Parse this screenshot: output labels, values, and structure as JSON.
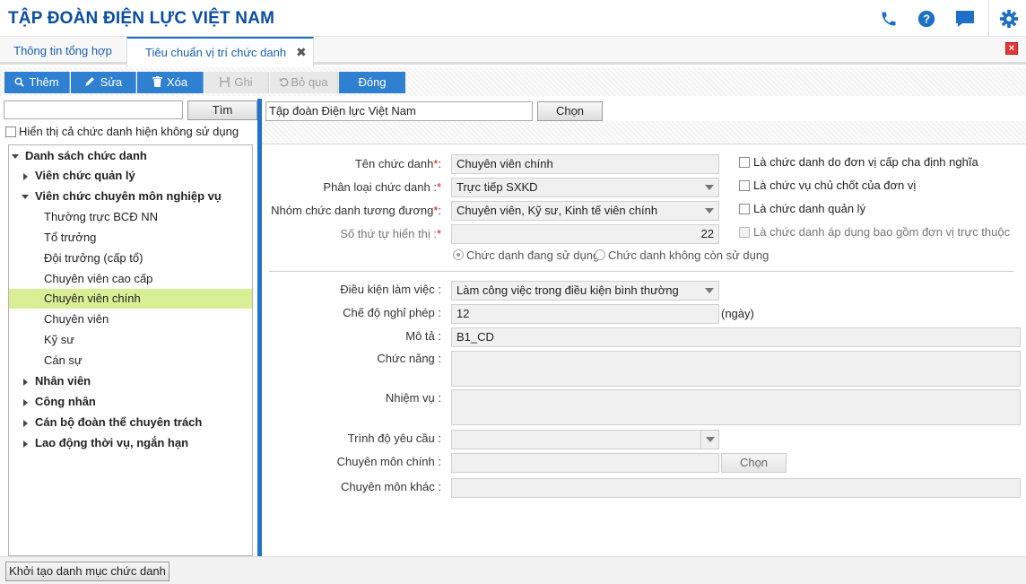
{
  "header": {
    "title": "TẬP ĐOÀN ĐIỆN LỰC VIỆT NAM",
    "icons": [
      "phone-icon",
      "help-icon",
      "chat-icon",
      "gear-icon"
    ],
    "accent": "#1e6fc6"
  },
  "tabs": [
    {
      "label": "Thông tin tổng hợp",
      "active": false
    },
    {
      "label": "Tiêu chuẩn vị trí chức danh",
      "active": true,
      "close": "✖"
    }
  ],
  "toolbar": {
    "add": "Thêm",
    "edit": "Sửa",
    "delete": "Xóa",
    "save": "Ghi",
    "skip": "Bỏ qua",
    "close": "Đóng"
  },
  "left": {
    "search_value": "",
    "search_button": "Tìm",
    "show_unused_label": "Hiển thị cả chức danh hiện không sử dụng",
    "tree": [
      {
        "label": "Danh sách chức danh",
        "level": 0,
        "expanded": true,
        "bold": true
      },
      {
        "label": "Viên chức quản lý",
        "level": 1,
        "expanded": false,
        "bold": true
      },
      {
        "label": "Viên chức chuyên môn nghiệp vụ",
        "level": 1,
        "expanded": true,
        "bold": true
      },
      {
        "label": "Thường trực BCĐ NN",
        "level": 2
      },
      {
        "label": "Tổ trưởng",
        "level": 2
      },
      {
        "label": "Đội trưởng (cấp tổ)",
        "level": 2
      },
      {
        "label": "Chuyên viên cao cấp",
        "level": 2
      },
      {
        "label": "Chuyên viên chính",
        "level": 2,
        "selected": true
      },
      {
        "label": "Chuyên viên",
        "level": 2
      },
      {
        "label": "Kỹ sư",
        "level": 2
      },
      {
        "label": "Cán sự",
        "level": 2
      },
      {
        "label": "Nhân viên",
        "level": 1,
        "expanded": false,
        "bold": true
      },
      {
        "label": "Công nhân",
        "level": 1,
        "expanded": false,
        "bold": true
      },
      {
        "label": "Cán bộ đoàn thể chuyên trách",
        "level": 1,
        "expanded": false,
        "bold": true
      },
      {
        "label": "Lao động thời vụ, ngắn hạn",
        "level": 1,
        "expanded": false,
        "bold": true
      }
    ],
    "init_button": "Khởi tạo danh mục chức danh"
  },
  "right": {
    "org_value": "Tập đoàn Điện lực Việt Nam",
    "org_choose": "Chọn",
    "fields": {
      "title_label": "Tên chức danh",
      "title_value": "Chuyên viên chính",
      "type_label": "Phân loại chức danh :",
      "type_value": "Trực tiếp SXKD",
      "group_label": "Nhóm chức danh tương đương",
      "group_value": "Chuyên viên, Kỹ sư, Kinh tế viên chính",
      "order_label": "Số thứ tự hiển thị :",
      "order_value": "22",
      "req_mark": "*",
      "colon_mark": ":"
    },
    "checks": {
      "c1": "Là chức danh do đơn vị cấp cha định nghĩa",
      "c2": "Là chức vụ chủ chốt của đơn vị",
      "c3": "Là chức danh quản lý",
      "c4": "Là chức danh áp dụng bao gồm đơn vị trực thuộc"
    },
    "status": {
      "in_use": "Chức danh đang sử dụng",
      "not_in_use": "Chức danh không còn sử dụng"
    },
    "details": {
      "condition_label": "Điều kiện làm việc :",
      "condition_value": "Làm công việc trong điều kiện bình thường",
      "leave_label": "Chế độ nghỉ phép :",
      "leave_value": "12",
      "leave_unit": "(ngày)",
      "desc_label": "Mô tả :",
      "desc_value": "B1_CD",
      "function_label": "Chức năng :",
      "function_value": "",
      "duty_label": "Nhiệm vụ :",
      "duty_value": "",
      "level_label": "Trình độ yêu cầu :",
      "level_value": "",
      "major_label": "Chuyên môn chính :",
      "major_value": "",
      "major_choose": "Chọn",
      "other_label": "Chuyên môn khác :",
      "other_value": ""
    }
  }
}
